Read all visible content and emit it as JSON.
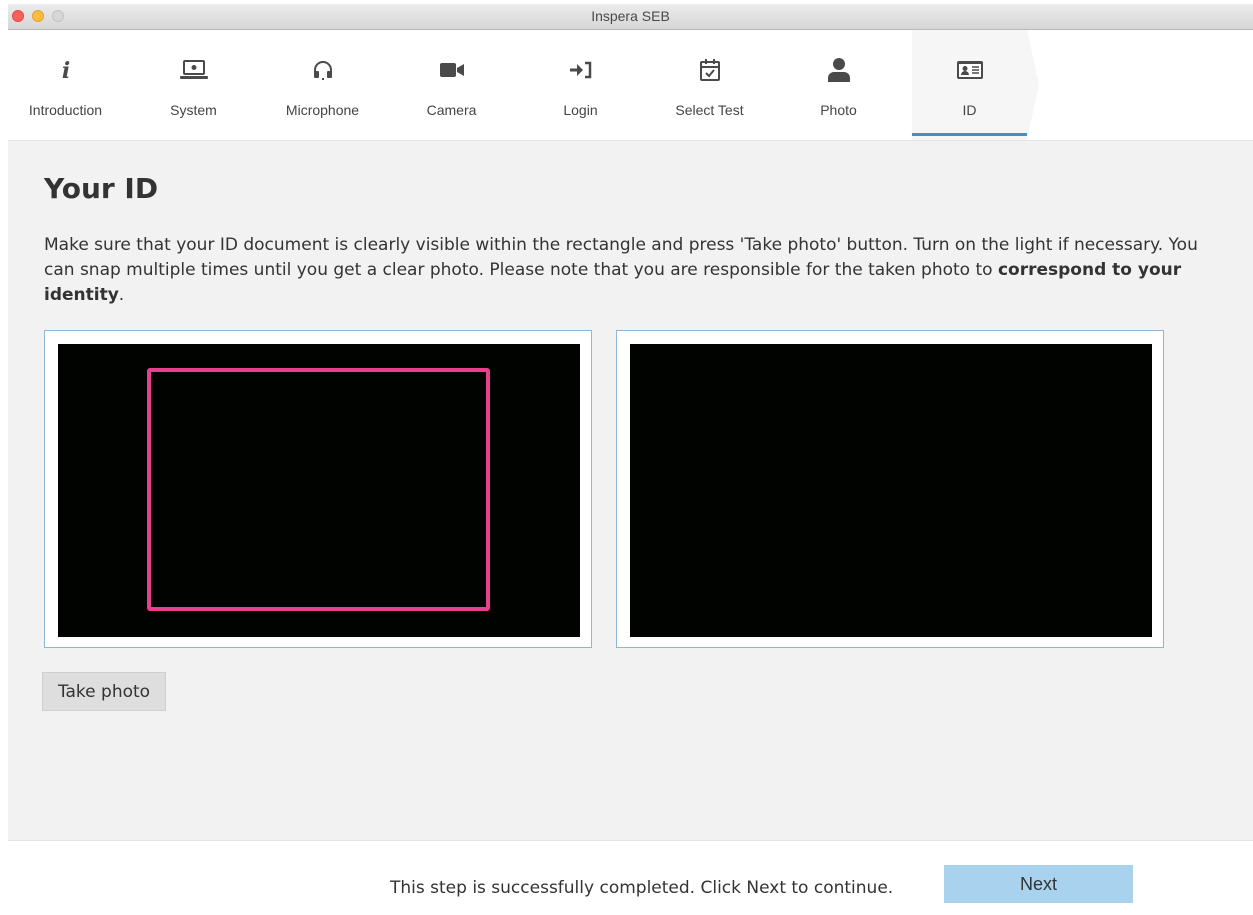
{
  "window": {
    "title": "Inspera SEB"
  },
  "steps": [
    {
      "label": "Introduction",
      "icon": "info-icon"
    },
    {
      "label": "System",
      "icon": "laptop-icon"
    },
    {
      "label": "Microphone",
      "icon": "headset-icon"
    },
    {
      "label": "Camera",
      "icon": "video-camera-icon"
    },
    {
      "label": "Login",
      "icon": "sign-in-icon"
    },
    {
      "label": "Select Test",
      "icon": "calendar-check-icon"
    },
    {
      "label": "Photo",
      "icon": "user-icon"
    },
    {
      "label": "ID",
      "icon": "id-card-icon",
      "active": true
    }
  ],
  "main": {
    "heading": "Your ID",
    "intro_text": "Make sure that your ID document is clearly visible within the rectangle and press 'Take photo' button. Turn on the light if necessary. You can snap multiple times until you get a clear photo. Please note that you are responsible for the taken photo to ",
    "intro_bold": "correspond to your identity",
    "intro_end": ".",
    "take_photo_label": "Take photo"
  },
  "footer": {
    "status": "This step is successfully completed. Click Next to continue.",
    "next_label": "Next"
  },
  "colors": {
    "accent": "#3b8fd4",
    "target_frame": "#e8408e",
    "next_button": "#a9d2ef"
  }
}
